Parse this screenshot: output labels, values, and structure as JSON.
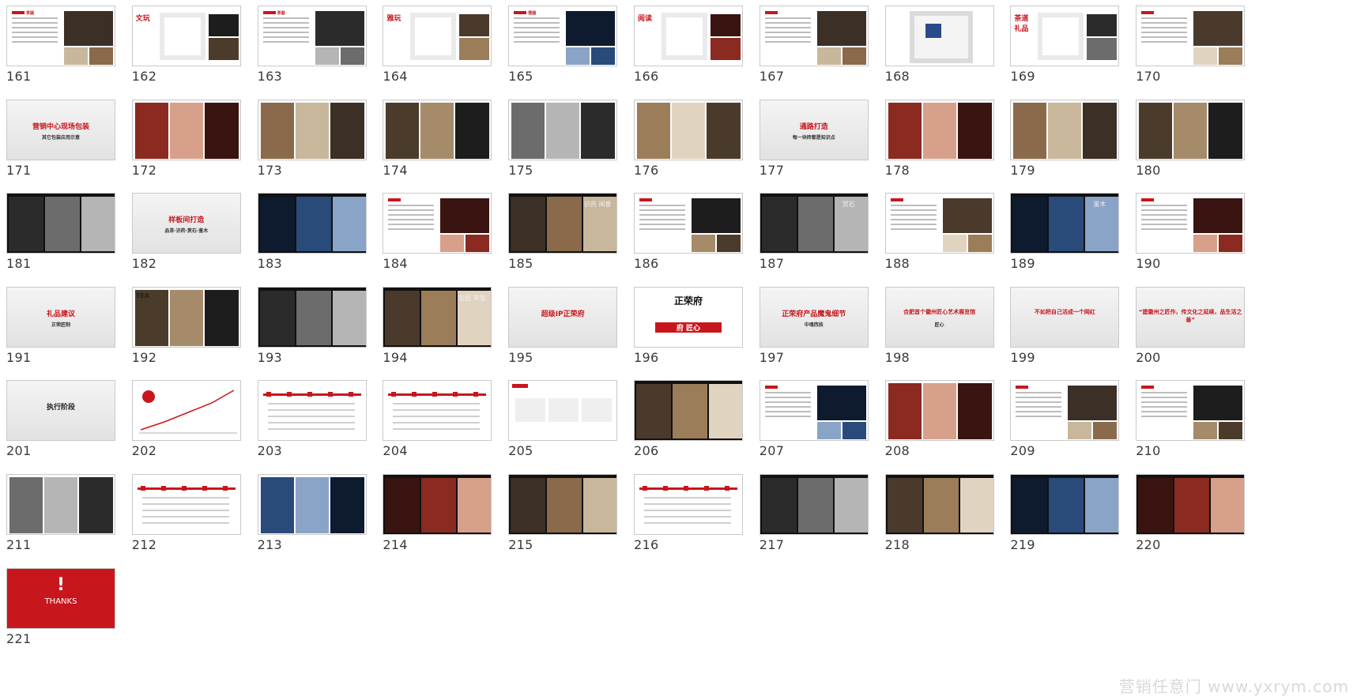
{
  "watermark": "营销任意门 www.yxrym.com",
  "slides": [
    {
      "n": "161",
      "kind": "text-img",
      "title": "茶器"
    },
    {
      "n": "162",
      "kind": "plan",
      "title": "文玩"
    },
    {
      "n": "163",
      "kind": "text-img",
      "title": "茶器"
    },
    {
      "n": "164",
      "kind": "plan",
      "title": "雅玩"
    },
    {
      "n": "165",
      "kind": "text-img",
      "title": "雅器"
    },
    {
      "n": "166",
      "kind": "plan",
      "title": "阅读"
    },
    {
      "n": "167",
      "kind": "text-img",
      "title": ""
    },
    {
      "n": "168",
      "kind": "floorplan",
      "title": ""
    },
    {
      "n": "169",
      "kind": "plan",
      "title": "茶道 礼品"
    },
    {
      "n": "170",
      "kind": "text-img",
      "title": ""
    },
    {
      "n": "171",
      "kind": "title",
      "title": "营销中心现场包装",
      "subtitle": "其它包装应用示意"
    },
    {
      "n": "172",
      "kind": "photos",
      "title": ""
    },
    {
      "n": "173",
      "kind": "photos",
      "title": ""
    },
    {
      "n": "174",
      "kind": "photos",
      "title": ""
    },
    {
      "n": "175",
      "kind": "photos",
      "title": ""
    },
    {
      "n": "176",
      "kind": "photos",
      "title": ""
    },
    {
      "n": "177",
      "kind": "title",
      "title": "通路打造",
      "subtitle": "每一块砖都是知识点"
    },
    {
      "n": "178",
      "kind": "photos",
      "title": ""
    },
    {
      "n": "179",
      "kind": "photos",
      "title": ""
    },
    {
      "n": "180",
      "kind": "photos",
      "title": ""
    },
    {
      "n": "181",
      "kind": "darkphotos",
      "title": ""
    },
    {
      "n": "182",
      "kind": "title",
      "title": "样板间打造",
      "subtitle": "品茶·识药·赏石·鉴木"
    },
    {
      "n": "183",
      "kind": "darkphotos",
      "title": ""
    },
    {
      "n": "184",
      "kind": "text-img",
      "title": ""
    },
    {
      "n": "185",
      "kind": "darkphotos",
      "title": "识药 闻香"
    },
    {
      "n": "186",
      "kind": "text-img",
      "title": ""
    },
    {
      "n": "187",
      "kind": "darkphotos",
      "title": "赏石"
    },
    {
      "n": "188",
      "kind": "text-img",
      "title": ""
    },
    {
      "n": "189",
      "kind": "darkphotos",
      "title": "鉴木"
    },
    {
      "n": "190",
      "kind": "text-img",
      "title": ""
    },
    {
      "n": "191",
      "kind": "title",
      "title": "礼品建议",
      "subtitle": "正荣匠制"
    },
    {
      "n": "192",
      "kind": "photos",
      "title": "TEA"
    },
    {
      "n": "193",
      "kind": "darkphotos",
      "title": ""
    },
    {
      "n": "194",
      "kind": "darkphotos",
      "title": "宣纸 宋笔"
    },
    {
      "n": "195",
      "kind": "title",
      "title": "超级IP正荣府",
      "subtitle": ""
    },
    {
      "n": "196",
      "kind": "diagram",
      "title": "正荣府",
      "subtitle": "府 匠心"
    },
    {
      "n": "197",
      "kind": "title",
      "title": "正荣府产品魔鬼细节",
      "subtitle": "中魂西技"
    },
    {
      "n": "198",
      "kind": "title",
      "title": "合肥首个徽州匠心艺术展览馆",
      "subtitle": "匠心"
    },
    {
      "n": "199",
      "kind": "title",
      "title": "不如把自己活成一个网红",
      "subtitle": ""
    },
    {
      "n": "200",
      "kind": "title",
      "title": "“建徽州之匠作，传文化之延续，品生活之善”",
      "subtitle": ""
    },
    {
      "n": "201",
      "kind": "title",
      "title": "执行阶段",
      "subtitle": ""
    },
    {
      "n": "202",
      "kind": "chart",
      "title": ""
    },
    {
      "n": "203",
      "kind": "timeline",
      "title": ""
    },
    {
      "n": "204",
      "kind": "timeline",
      "title": ""
    },
    {
      "n": "205",
      "kind": "text",
      "title": ""
    },
    {
      "n": "206",
      "kind": "darkphotos",
      "title": ""
    },
    {
      "n": "207",
      "kind": "text-img",
      "title": ""
    },
    {
      "n": "208",
      "kind": "photos",
      "title": ""
    },
    {
      "n": "209",
      "kind": "text-img",
      "title": ""
    },
    {
      "n": "210",
      "kind": "text-img",
      "title": ""
    },
    {
      "n": "211",
      "kind": "photos",
      "title": ""
    },
    {
      "n": "212",
      "kind": "timeline",
      "title": ""
    },
    {
      "n": "213",
      "kind": "photos",
      "title": ""
    },
    {
      "n": "214",
      "kind": "darkphotos",
      "title": ""
    },
    {
      "n": "215",
      "kind": "darkphotos",
      "title": ""
    },
    {
      "n": "216",
      "kind": "timeline",
      "title": ""
    },
    {
      "n": "217",
      "kind": "darkphotos",
      "title": ""
    },
    {
      "n": "218",
      "kind": "darkphotos",
      "title": ""
    },
    {
      "n": "219",
      "kind": "darkphotos",
      "title": ""
    },
    {
      "n": "220",
      "kind": "darkphotos",
      "title": ""
    },
    {
      "n": "221",
      "kind": "thanks",
      "title": "THANKS",
      "subtitle": "!"
    }
  ],
  "colors": {
    "red": "#c8161d",
    "border": "#c9c9c9",
    "num": "#3a3a3a"
  }
}
